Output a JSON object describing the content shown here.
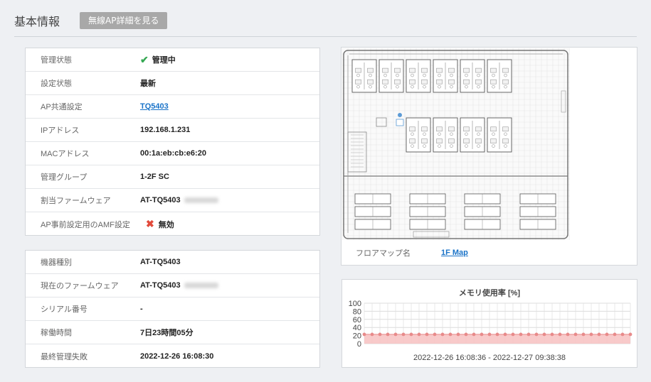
{
  "header": {
    "title": "基本情報",
    "detail_button": "無線AP詳細を見る"
  },
  "basic_info": [
    {
      "label": "管理状態",
      "value": "管理中",
      "status": "check"
    },
    {
      "label": "設定状態",
      "value": "最新"
    },
    {
      "label": "AP共通設定",
      "value": "TQ5403",
      "link": true
    },
    {
      "label": "IPアドレス",
      "value": "192.168.1.231"
    },
    {
      "label": "MACアドレス",
      "value": "00:1a:eb:cb:e6:20"
    },
    {
      "label": "管理グループ",
      "value": "1-2F SC"
    },
    {
      "label": "割当ファームウェア",
      "value": "AT-TQ5403",
      "blurred": true
    },
    {
      "label": "AP事前設定用のAMF設定",
      "value": "無効",
      "status": "cross"
    }
  ],
  "device_info": [
    {
      "label": "機器種別",
      "value": "AT-TQ5403"
    },
    {
      "label": "現在のファームウェア",
      "value": "AT-TQ5403",
      "blurred": true
    },
    {
      "label": "シリアル番号",
      "value": "-"
    },
    {
      "label": "稼働時間",
      "value": "7日23時間05分"
    },
    {
      "label": "最終管理失敗",
      "value": "2022-12-26 16:08:30"
    }
  ],
  "floor_map": {
    "label": "フロアマップ名",
    "link": "1F Map"
  },
  "chart_data": {
    "type": "line",
    "title": "メモリ使用率 [%]",
    "ylim": [
      0,
      100
    ],
    "yticks": [
      "100",
      "80",
      "60",
      "40",
      "20",
      "0"
    ],
    "xrange_label": "2022-12-26 16:08:36 - 2022-12-27 09:38:38",
    "series": [
      {
        "values": [
          23,
          23,
          23,
          23,
          23,
          23,
          23,
          23,
          23,
          23,
          23,
          23,
          23,
          23,
          23,
          23,
          23,
          23,
          23,
          23,
          23,
          23,
          23,
          23,
          23,
          23,
          23,
          23,
          23,
          23,
          23,
          23,
          23,
          23,
          23
        ]
      }
    ],
    "grid": true,
    "line_color": "#e88a8a",
    "fill_color": "#f7c4c4"
  }
}
